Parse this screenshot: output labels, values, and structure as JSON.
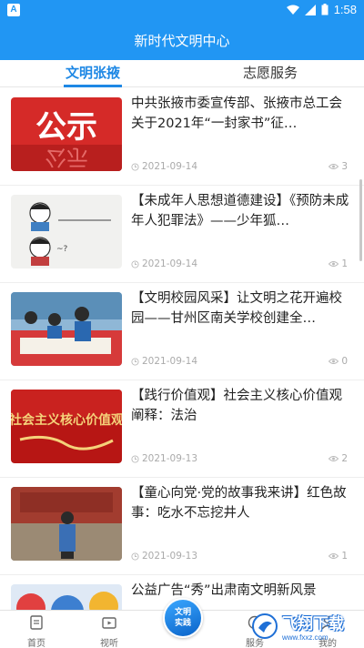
{
  "status_bar": {
    "app_badge": "A",
    "time": "1:58"
  },
  "header": {
    "title": "新时代文明中心"
  },
  "tabs": [
    {
      "label": "文明张掖",
      "active": true
    },
    {
      "label": "志愿服务",
      "active": false
    }
  ],
  "articles": [
    {
      "title": "中共张掖市委宣传部、张掖市总工会关于2021年“一封家书”征…",
      "date": "2021-09-14",
      "views": "3",
      "thumb_text": "公示"
    },
    {
      "title": "【未成年人思想道德建设】《预防未成年人犯罪法》——少年狐…",
      "date": "2021-09-14",
      "views": "1"
    },
    {
      "title": "【文明校园风采】让文明之花开遍校园——甘州区南关学校创建全…",
      "date": "2021-09-14",
      "views": "0"
    },
    {
      "title": "【践行价值观】社会主义核心价值观阐释：法治",
      "date": "2021-09-13",
      "views": "2",
      "thumb_text": "社会主义核心价值观"
    },
    {
      "title": "【童心向党·党的故事我来讲】红色故事：吃水不忘挖井人",
      "date": "2021-09-13",
      "views": "1"
    },
    {
      "title": "公益广告“秀”出肃南文明新风景",
      "date": "",
      "views": ""
    }
  ],
  "bottom_nav": [
    {
      "label": "首页",
      "icon": "home-doc-icon"
    },
    {
      "label": "视听",
      "icon": "video-icon"
    },
    {
      "label": "文明实践",
      "icon": "center-logo-icon"
    },
    {
      "label": "服务",
      "icon": "service-icon"
    },
    {
      "label": "我的",
      "icon": "profile-icon"
    }
  ],
  "watermark": {
    "text": "飞翔下载",
    "sub": "www.fxxz.com"
  },
  "colors": {
    "primary": "#2196f3",
    "tab_active": "#1e88e5",
    "meta": "#aaaaaa"
  }
}
